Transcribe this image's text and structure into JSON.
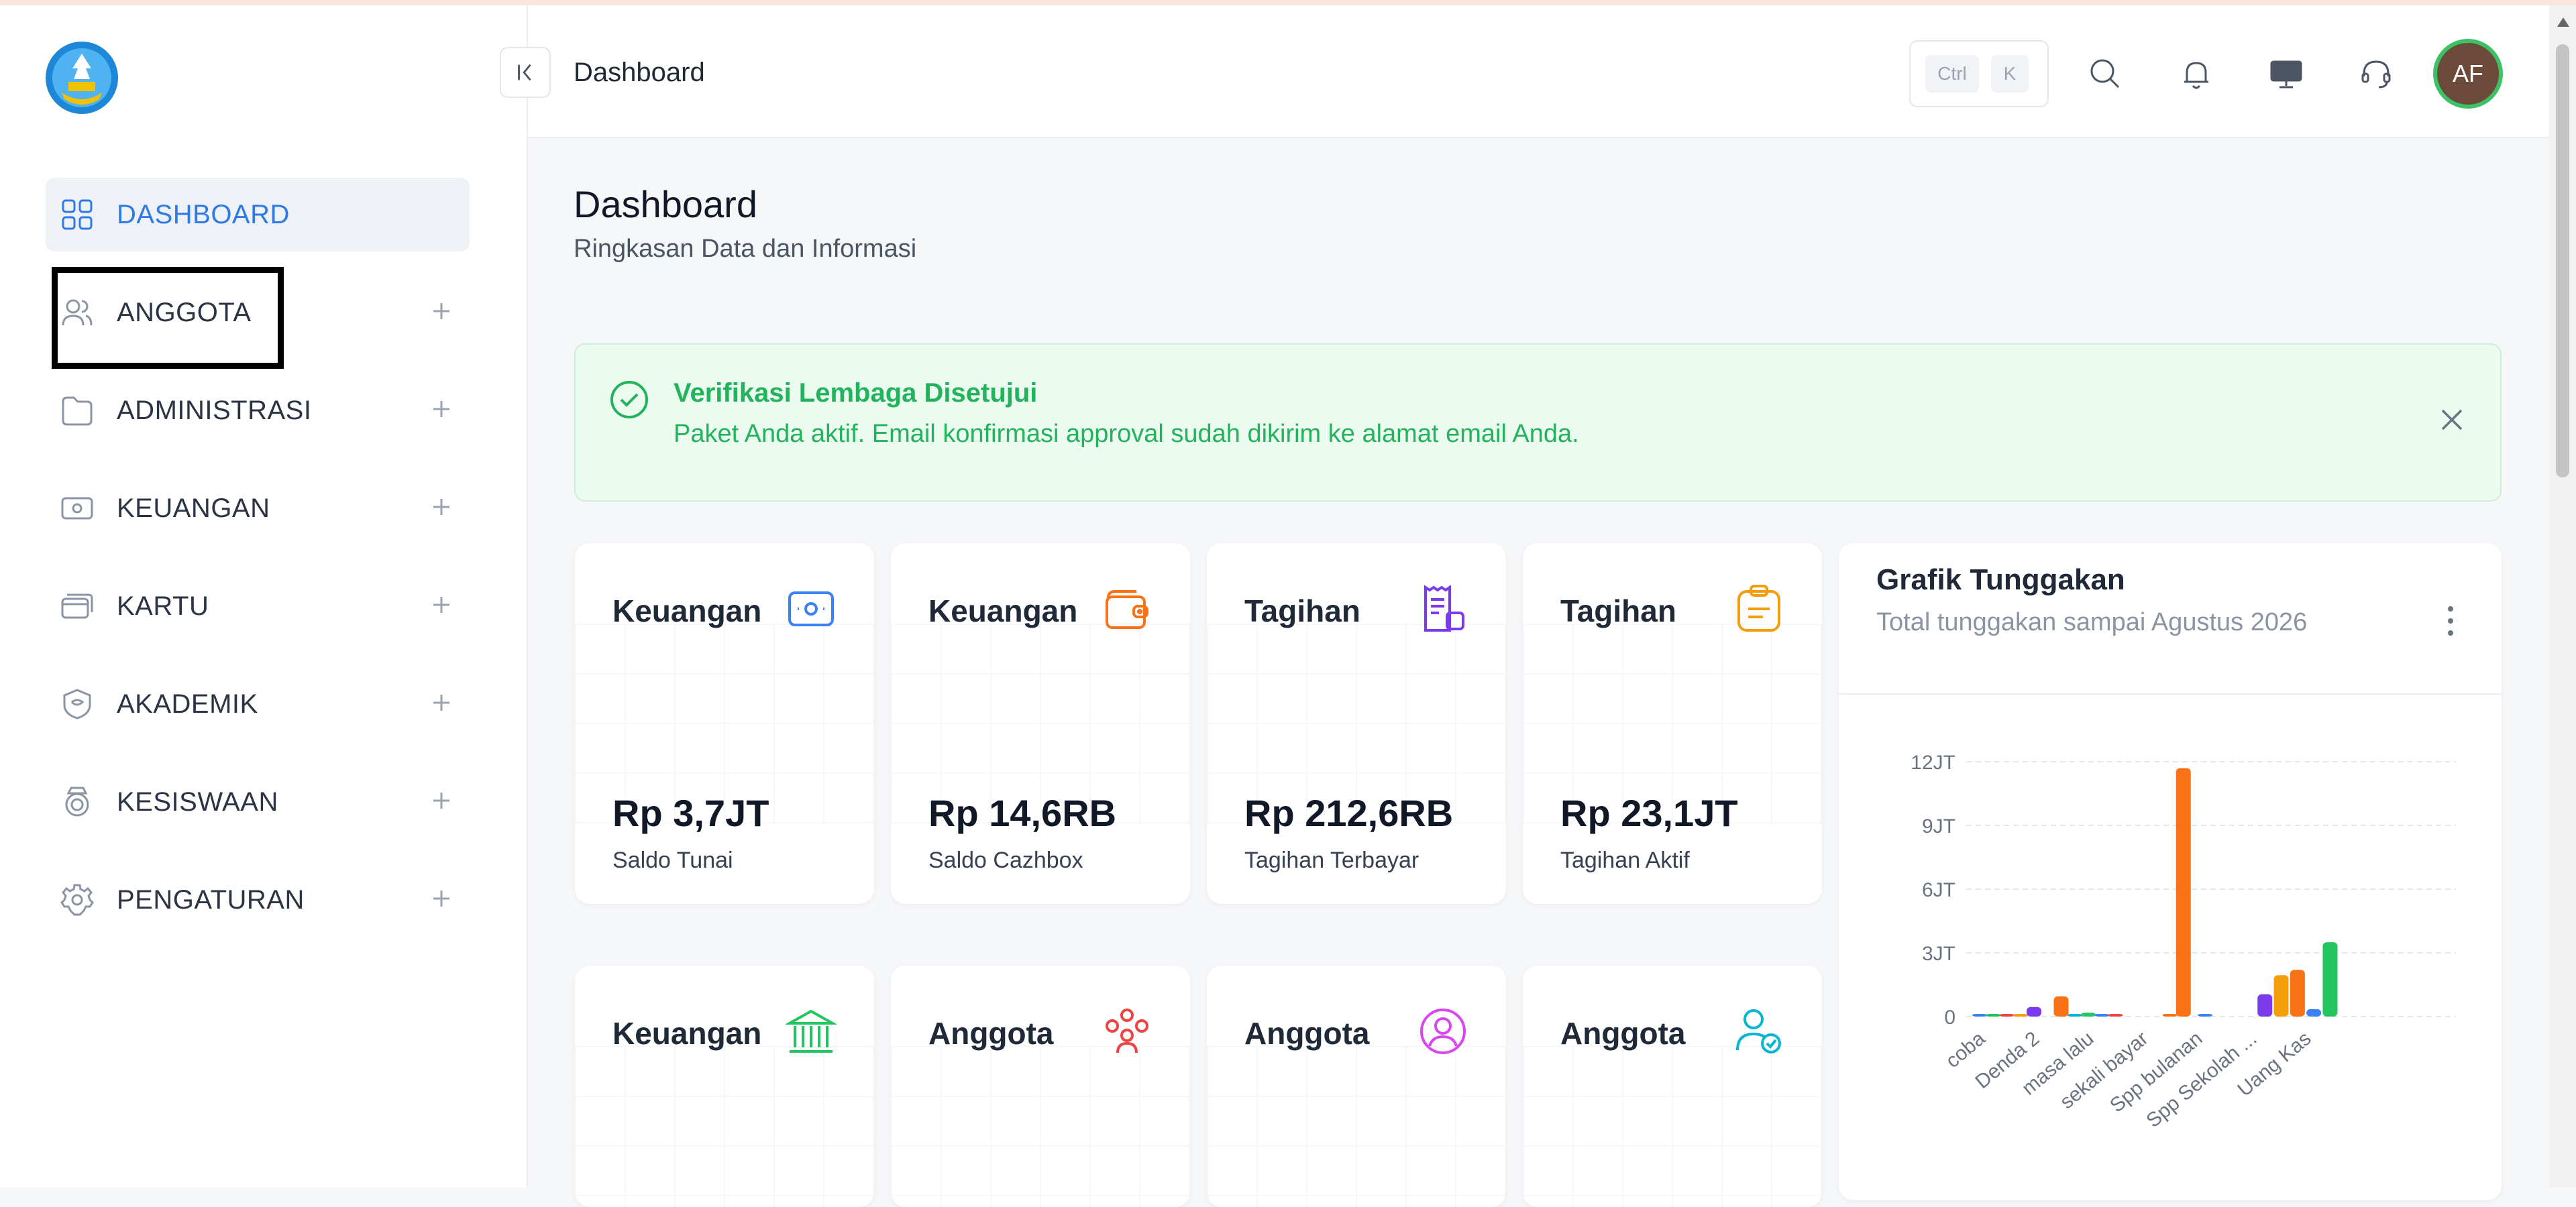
{
  "header": {
    "title": "Dashboard",
    "shortcut": [
      "Ctrl",
      "K"
    ],
    "avatar_initials": "AF"
  },
  "sidebar": {
    "items": [
      {
        "label": "DASHBOARD",
        "icon": "grid-icon",
        "active": true
      },
      {
        "label": "ANGGOTA",
        "icon": "users-icon"
      },
      {
        "label": "ADMINISTRASI",
        "icon": "folder-icon"
      },
      {
        "label": "KEUANGAN",
        "icon": "money-icon"
      },
      {
        "label": "KARTU",
        "icon": "card-icon"
      },
      {
        "label": "AKADEMIK",
        "icon": "academic-icon"
      },
      {
        "label": "KESISWAAN",
        "icon": "student-icon"
      },
      {
        "label": "PENGATURAN",
        "icon": "gear-icon"
      }
    ]
  },
  "page": {
    "title": "Dashboard",
    "subtitle": "Ringkasan Data dan Informasi"
  },
  "alert": {
    "title": "Verifikasi Lembaga Disetujui",
    "message": "Paket Anda aktif. Email konfirmasi approval sudah dikirim ke alamat email Anda."
  },
  "cards": [
    {
      "title": "Keuangan",
      "value": "Rp 3,7JT",
      "label": "Saldo Tunai",
      "icon": "cash-icon",
      "color": "#3b82f6"
    },
    {
      "title": "Keuangan",
      "value": "Rp 14,6RB",
      "label": "Saldo Cazhbox",
      "icon": "wallet-icon",
      "color": "#f97316"
    },
    {
      "title": "Tagihan",
      "value": "Rp 212,6RB",
      "label": "Tagihan Terbayar",
      "icon": "receipt-icon",
      "color": "#7c3aed"
    },
    {
      "title": "Tagihan",
      "value": "Rp 23,1JT",
      "label": "Tagihan Aktif",
      "icon": "clipboard-icon",
      "color": "#f59e0b"
    },
    {
      "title": "Keuangan",
      "icon": "bank-icon",
      "color": "#22c55e"
    },
    {
      "title": "Anggota",
      "icon": "group-icon",
      "color": "#ef4444"
    },
    {
      "title": "Anggota",
      "icon": "user-circle-icon",
      "color": "#d946ef"
    },
    {
      "title": "Anggota",
      "icon": "user-check-icon",
      "color": "#06b6d4"
    }
  ],
  "chart": {
    "title": "Grafik Tunggakan",
    "subtitle": "Total tunggakan sampai Agustus 2026"
  },
  "chart_data": {
    "type": "bar",
    "title": "Grafik Tunggakan",
    "subtitle": "Total tunggakan sampai Agustus 2026",
    "ylim": [
      0,
      12
    ],
    "yticks": [
      {
        "v": 0,
        "label": "0"
      },
      {
        "v": 3,
        "label": "3JT"
      },
      {
        "v": 6,
        "label": "6JT"
      },
      {
        "v": 9,
        "label": "9JT"
      },
      {
        "v": 12,
        "label": "12JT"
      }
    ],
    "tick_labels": [
      {
        "label": "coba",
        "slot": 0
      },
      {
        "label": "Denda 2",
        "slot": 2
      },
      {
        "label": "masa lalu",
        "slot": 4
      },
      {
        "label": "sekali bayar",
        "slot": 6
      },
      {
        "label": "Spp bulanan",
        "slot": 8
      },
      {
        "label": "Spp Sekolah ...",
        "slot": 10
      },
      {
        "label": "Uang Kas",
        "slot": 12
      }
    ],
    "bars": [
      {
        "slot": 0,
        "value": 0.12,
        "color": "#3b82f6"
      },
      {
        "slot": 0.5,
        "value": 0.05,
        "color": "#22c55e"
      },
      {
        "slot": 1,
        "value": 0.08,
        "color": "#ef4444"
      },
      {
        "slot": 1.5,
        "value": 0.05,
        "color": "#f59e0b"
      },
      {
        "slot": 2,
        "value": 0.45,
        "color": "#7c3aed"
      },
      {
        "slot": 3,
        "value": 0.95,
        "color": "#f97316"
      },
      {
        "slot": 3.5,
        "value": 0.05,
        "color": "#06b6d4"
      },
      {
        "slot": 4,
        "value": 0.18,
        "color": "#22c55e"
      },
      {
        "slot": 4.5,
        "value": 0.05,
        "color": "#3b82f6"
      },
      {
        "slot": 5,
        "value": 0.05,
        "color": "#ef4444"
      },
      {
        "slot": 7,
        "value": 0.1,
        "color": "#f97316"
      },
      {
        "slot": 7.5,
        "value": 11.7,
        "color": "#f97316"
      },
      {
        "slot": 8.3,
        "value": 0.08,
        "color": "#3b82f6"
      },
      {
        "slot": 10.5,
        "value": 1.05,
        "color": "#7c3aed"
      },
      {
        "slot": 11.1,
        "value": 1.95,
        "color": "#f59e0b"
      },
      {
        "slot": 11.7,
        "value": 2.2,
        "color": "#f97316"
      },
      {
        "slot": 12.3,
        "value": 0.35,
        "color": "#3b82f6"
      },
      {
        "slot": 12.9,
        "value": 3.5,
        "color": "#22c55e"
      }
    ]
  }
}
